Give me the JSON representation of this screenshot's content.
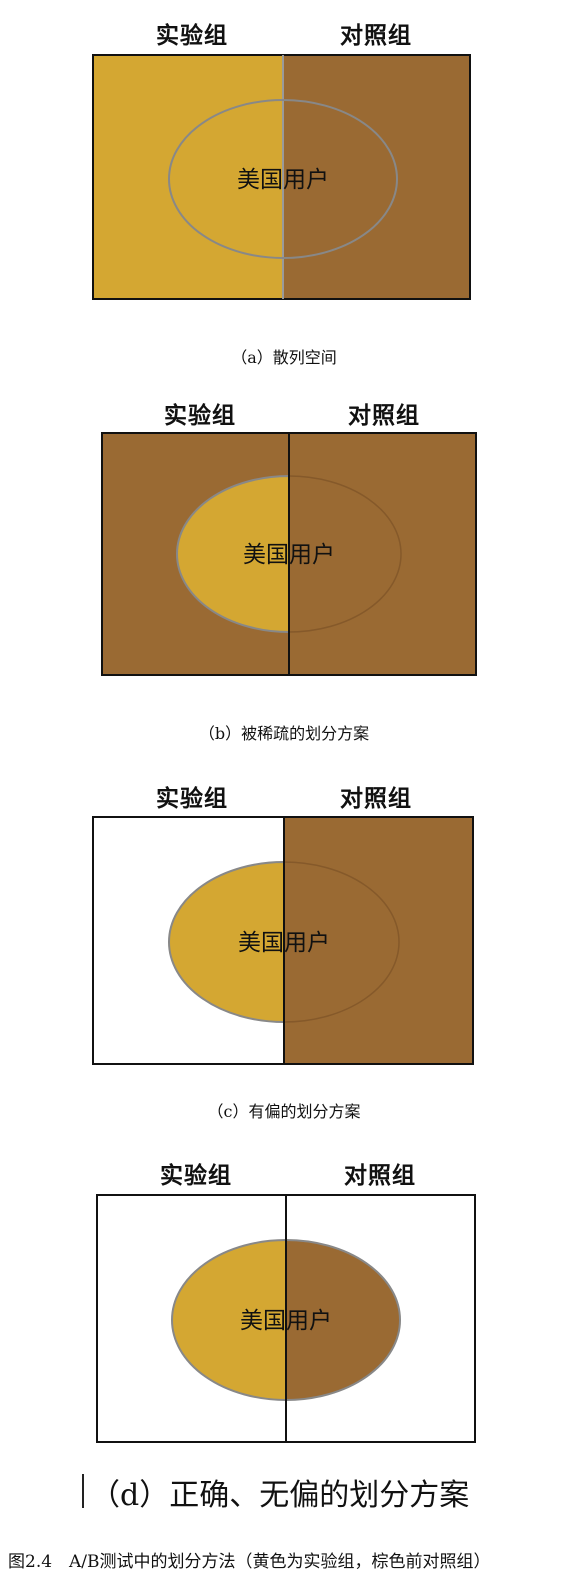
{
  "colors": {
    "experiment": "#d4a732",
    "control": "#9a6a33",
    "white": "#ffffff",
    "border": "#111111",
    "ellipse_stroke": "#888888"
  },
  "panels": [
    {
      "header_left": "实验组",
      "header_right": "对照组",
      "ellipse_label": "美国用户",
      "caption": "（a）散列空间"
    },
    {
      "header_left": "实验组",
      "header_right": "对照组",
      "ellipse_label": "美国用户",
      "caption": "（b）被稀疏的划分方案"
    },
    {
      "header_left": "实验组",
      "header_right": "对照组",
      "ellipse_label": "美国用户",
      "caption": "（c）有偏的划分方案"
    },
    {
      "header_left": "实验组",
      "header_right": "对照组",
      "ellipse_label": "美国用户",
      "caption": "（d）正确、无偏的划分方案"
    }
  ],
  "figure_caption": "图2.4　A/B测试中的划分方法（黄色为实验组，棕色前对照组）"
}
